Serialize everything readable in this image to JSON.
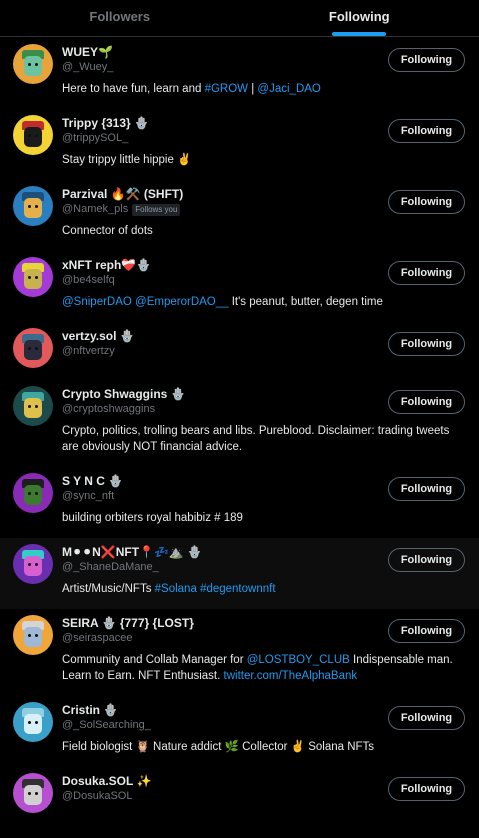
{
  "tabs": {
    "followers": "Followers",
    "following": "Following"
  },
  "accent": "#1d9bf0",
  "follow_label": "Following",
  "users": [
    {
      "name": "WUEY🌱",
      "handle": "@_Wuey_",
      "follows_you": "",
      "bio": [
        {
          "t": "Here to have fun, learn and ",
          "link": false
        },
        {
          "t": "#GROW",
          "link": true
        },
        {
          "t": " | ",
          "link": false
        },
        {
          "t": "@Jaci_DAO",
          "link": true
        }
      ],
      "avatar": {
        "bg": "#e8a33a",
        "face": "#6cc3a0",
        "hat": "#3a8d4a"
      }
    },
    {
      "name": "Trippy {313} 🪬",
      "handle": "@trippySOL_",
      "follows_you": "",
      "bio": [
        {
          "t": "Stay trippy little hippie ✌️",
          "link": false
        }
      ],
      "avatar": {
        "bg": "#f2d534",
        "face": "#1b1b1b",
        "hat": "#c02d2d"
      }
    },
    {
      "name": "Parzival 🔥⚒️ (SHFT)",
      "handle": "@Namek_pls",
      "follows_you": "Follows you",
      "bio": [
        {
          "t": "Connector of dots",
          "link": false
        }
      ],
      "avatar": {
        "bg": "#2a7fc0",
        "face": "#e3b04b",
        "hat": "#1d4f7a"
      }
    },
    {
      "name": "xNFT reph❤️‍🩹🪬",
      "handle": "@be4selfq",
      "follows_you": "",
      "bio": [
        {
          "t": "@SniperDAO",
          "link": true
        },
        {
          "t": " ",
          "link": false
        },
        {
          "t": "@EmperorDAO__",
          "link": true
        },
        {
          "t": " It's peanut, butter, degen time",
          "link": false
        }
      ],
      "avatar": {
        "bg": "#a53bd6",
        "face": "#c9b14e",
        "hat": "#e7d43a"
      }
    },
    {
      "name": "vertzy.sol 🪬",
      "handle": "@nftvertzy",
      "follows_you": "",
      "bio": [],
      "avatar": {
        "bg": "#e2595b",
        "face": "#2a2a3a",
        "hat": "#3c6b8c"
      }
    },
    {
      "name": "Crypto Shwaggins 🪬",
      "handle": "@cryptoshwaggins",
      "follows_you": "",
      "bio": [
        {
          "t": "Crypto, politics, trolling bears and libs. Pureblood. Disclaimer: trading tweets are obviously NOT financial advice.",
          "link": false
        }
      ],
      "avatar": {
        "bg": "#1d4a4a",
        "face": "#e0c04c",
        "hat": "#3fa7a0"
      }
    },
    {
      "name": "S Y N C 🪬",
      "handle": "@sync_nft",
      "follows_you": "",
      "bio": [
        {
          "t": "building orbiters royal habibiz # 189",
          "link": false
        }
      ],
      "avatar": {
        "bg": "#8a2bb8",
        "face": "#3b7a2f",
        "hat": "#1e1e1e"
      }
    },
    {
      "name": "M⚫⚫N❌NFT📍💤⛰️ 🪬",
      "handle": "@_ShaneDaMane_",
      "follows_you": "",
      "bio": [
        {
          "t": "Artist/Music/NFTs ",
          "link": false
        },
        {
          "t": "#Solana",
          "link": true
        },
        {
          "t": " ",
          "link": false
        },
        {
          "t": "#degentownnft",
          "link": true
        }
      ],
      "avatar": {
        "bg": "#6a2fb0",
        "face": "#d85fd0",
        "hat": "#2fcfc7"
      }
    },
    {
      "name": "SEIRA 🪬 {777} {LOST}",
      "handle": "@seiraspacee",
      "follows_you": "",
      "bio": [
        {
          "t": "Community and Collab Manager for ",
          "link": false
        },
        {
          "t": "@LOSTBOY_CLUB",
          "link": true
        },
        {
          "t": " Indispensable man. Learn to Earn. NFT Enthusiast. ",
          "link": false
        },
        {
          "t": "twitter.com/TheAlphaBank",
          "link": true
        }
      ],
      "avatar": {
        "bg": "#f0a63a",
        "face": "#9fb8d6",
        "hat": "#d4d4d4"
      }
    },
    {
      "name": "Cristin 🪬",
      "handle": "@_SolSearching_",
      "follows_you": "",
      "bio": [
        {
          "t": "Field biologist 🦉 Nature addict 🌿 Collector ✌️ Solana NFTs",
          "link": false
        }
      ],
      "avatar": {
        "bg": "#3aa0c9",
        "face": "#d6f0f5",
        "hat": "#8fd0e0"
      }
    },
    {
      "name": "Dosuka.SOL ✨",
      "handle": "@DosukaSOL",
      "follows_you": "",
      "bio": [],
      "avatar": {
        "bg": "#b64fd0",
        "face": "#d0d0d0",
        "hat": "#303030"
      }
    }
  ]
}
